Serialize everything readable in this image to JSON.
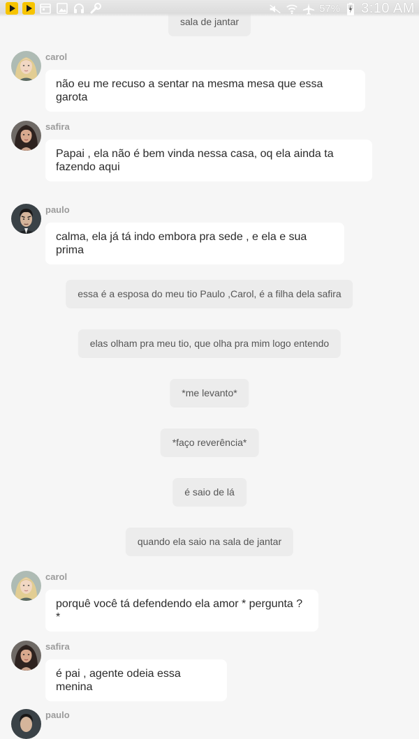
{
  "status_bar": {
    "left_icons": [
      "play-store-icon",
      "play-store-icon",
      "calendar-icon",
      "image-icon",
      "headset-icon",
      "wrench-icon"
    ],
    "right_icons": [
      "mute-icon",
      "wifi-icon",
      "airplane-icon",
      "battery-charging-icon"
    ],
    "battery": "57%",
    "time": "3:10 AM"
  },
  "chat": {
    "narration_top": "sala de jantar",
    "messages": [
      {
        "sender": "carol",
        "text": "não eu me recuso a sentar na mesma mesa que essa garota"
      },
      {
        "sender": "safira",
        "text": "Papai , ela não é bem vinda nessa casa, oq ela ainda ta fazendo aqui"
      },
      {
        "sender": "paulo",
        "text": "calma, ela já tá indo embora pra sede , e ela e sua prima"
      },
      {
        "sender": "carol",
        "text": "porquê você tá defendendo ela amor * pergunta ? *"
      },
      {
        "sender": "safira",
        "text": "é pai , agente odeia essa menina"
      }
    ],
    "narrations": [
      "essa é a esposa do meu tio Paulo ,Carol, é a filha dela safira",
      "elas olham pra meu tio, que olha pra mim logo entendo",
      "*me levanto*",
      "*faço reverência*",
      "é saio de lá",
      "quando ela saio na sala de jantar"
    ],
    "partial_sender": "paulo"
  },
  "colors": {
    "background": "#f6f6f6",
    "bubble": "#ffffff",
    "narration_bubble": "#ececec",
    "sender_name": "#9b9b9b",
    "status_icon_yellow": "#f7c400"
  }
}
